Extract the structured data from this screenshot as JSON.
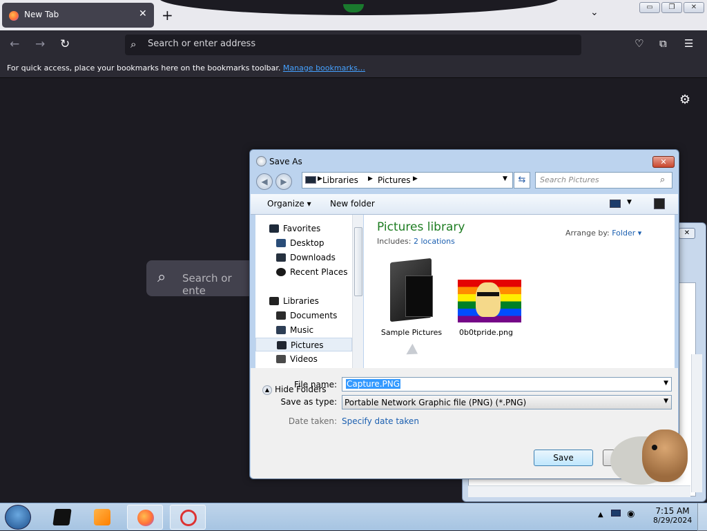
{
  "browser": {
    "tab_title": "New Tab",
    "tab_close": "✕",
    "new_tab": "+",
    "tab_overflow": "⌄",
    "address_placeholder": "Search or enter address",
    "bookmarks_bar_text": "For quick access, place your bookmarks here on the bookmarks toolbar.",
    "bookmarks_link": "Manage bookmarks…",
    "newtab_search_placeholder": "Search or ente",
    "icons": [
      "back-icon",
      "forward-icon",
      "reload-icon",
      "pocket-icon",
      "extensions-icon",
      "menu-icon",
      "settings-gear-icon"
    ]
  },
  "window_controls": {
    "minimize": "▭",
    "restore": "❐",
    "close": "✕"
  },
  "background_window": {
    "close": "✕"
  },
  "dialog": {
    "title": "Save As",
    "close": "✕",
    "breadcrumb": [
      "Libraries",
      "Pictures"
    ],
    "search_placeholder": "Search Pictures",
    "toolbar": {
      "organize": "Organize",
      "new_folder": "New folder"
    },
    "tree": {
      "favorites_header": "Favorites",
      "favorites": [
        "Desktop",
        "Downloads",
        "Recent Places"
      ],
      "libraries_header": "Libraries",
      "libraries": [
        "Documents",
        "Music",
        "Pictures",
        "Videos"
      ],
      "selected": "Pictures"
    },
    "library": {
      "title": "Pictures library",
      "includes_label": "Includes:",
      "includes_link": "2 locations",
      "arrange_label": "Arrange by:",
      "arrange_value": "Folder"
    },
    "items": [
      {
        "name": "Sample Pictures",
        "type": "folder"
      },
      {
        "name": "0b0tpride.png",
        "type": "image"
      }
    ],
    "form": {
      "file_name_label": "File name:",
      "file_name_value": "Capture.PNG",
      "save_type_label": "Save as type:",
      "save_type_value": "Portable Network Graphic file (PNG) (*.PNG)",
      "date_taken_label": "Date taken:",
      "date_taken_value": "Specify date taken"
    },
    "hide_folders": "Hide Folders",
    "save_button": "Save",
    "cancel_button": "Ca"
  },
  "taskbar": {
    "time": "7:15 AM",
    "date": "8/29/2024",
    "pinned": [
      "media-center-icon",
      "media-player-icon",
      "firefox-icon",
      "snipping-tool-icon"
    ]
  },
  "colors": {
    "library_title": "#1e7d22",
    "link": "#1b5fb0",
    "selection": "#3399ff"
  }
}
